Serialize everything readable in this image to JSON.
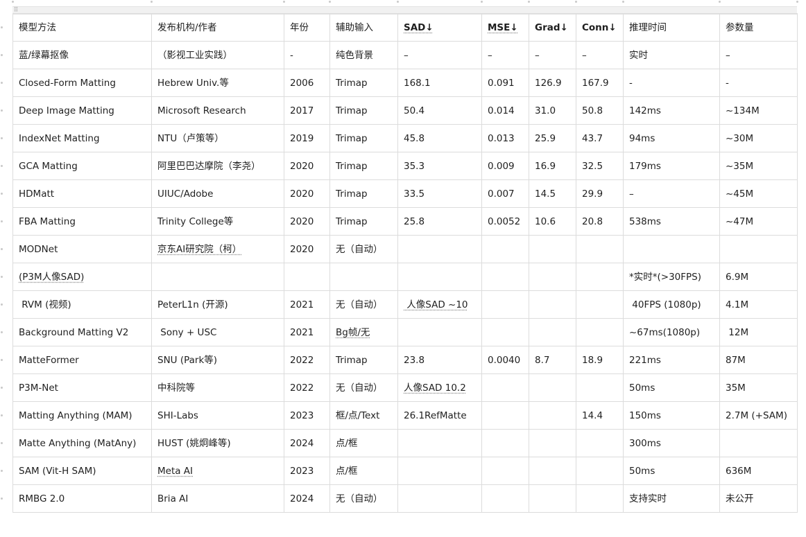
{
  "table": {
    "header": [
      "模型方法",
      "发布机构/作者",
      "年份",
      "辅助输入",
      "SAD↓",
      "MSE↓",
      "Grad↓",
      "Conn↓",
      "推理时间",
      "参数量"
    ],
    "rows": [
      [
        "蓝/绿幕抠像",
        "（影视工业实践）",
        "-",
        "纯色背景",
        "–",
        "–",
        "–",
        "–",
        "实时",
        "–"
      ],
      [
        "Closed-Form Matting",
        "Hebrew Univ.等",
        "2006",
        "Trimap",
        "168.1",
        "0.091",
        "126.9",
        "167.9",
        "-",
        "-"
      ],
      [
        "Deep Image Matting",
        "Microsoft Research",
        "2017",
        "Trimap",
        "50.4",
        "0.014",
        "31.0",
        "50.8",
        "142ms",
        "~134M"
      ],
      [
        "IndexNet Matting",
        "NTU（卢策等）",
        "2019",
        "Trimap",
        "45.8",
        "0.013",
        "25.9",
        "43.7",
        "94ms",
        "~30M"
      ],
      [
        "GCA Matting",
        "阿里巴巴达摩院（李尧）",
        "2020",
        "Trimap",
        "35.3",
        "0.009",
        "16.9",
        "32.5",
        "179ms",
        "~35M"
      ],
      [
        "HDMatt",
        "UIUC/Adobe",
        "2020",
        "Trimap",
        "33.5",
        "0.007",
        "14.5",
        "29.9",
        "–",
        "~45M"
      ],
      [
        "FBA Matting",
        "Trinity College等",
        "2020",
        "Trimap",
        "25.8",
        "0.0052",
        "10.6",
        "20.8",
        "538ms",
        "~47M"
      ],
      [
        "MODNet",
        "京东AI研究院（柯）",
        "2020",
        "无（自动）",
        "",
        "",
        "",
        "",
        "",
        ""
      ],
      [
        "(P3M人像SAD)",
        "",
        "",
        "",
        "",
        "",
        "",
        "",
        "*实时*(>30FPS)",
        "6.9M"
      ],
      [
        " RVM (视频)",
        "PeterL1n (开源)",
        "2021",
        "无（自动）",
        " 人像SAD ~10",
        "",
        "",
        "",
        " 40FPS (1080p)",
        "4.1M"
      ],
      [
        "Background Matting V2",
        " Sony + USC",
        "2021",
        "Bg帧/无",
        "",
        "",
        "",
        "",
        "~67ms(1080p)",
        " 12M"
      ],
      [
        "MatteFormer",
        "SNU (Park等)",
        "2022",
        "Trimap",
        "23.8",
        "0.0040",
        "8.7",
        "18.9",
        "221ms",
        "87M"
      ],
      [
        "P3M-Net",
        "中科院等",
        "2022",
        "无（自动）",
        "人像SAD 10.2",
        "",
        "",
        "",
        "50ms",
        "35M"
      ],
      [
        "Matting Anything (MAM)",
        "SHI-Labs",
        "2023",
        "框/点/Text",
        "26.1RefMatte",
        "",
        "",
        "14.4",
        "150ms",
        "2.7M (+SAM)"
      ],
      [
        "Matte Anything (MatAny)",
        "HUST (姚炯峰等)",
        "2024",
        "点/框",
        "",
        "",
        "",
        "",
        "300ms",
        ""
      ],
      [
        "SAM (Vit-H SAM)",
        "Meta AI",
        "2023",
        "点/框",
        "",
        "",
        "",
        "",
        "50ms",
        "636M"
      ],
      [
        "RMBG 2.0",
        "Bria AI",
        "2024",
        "无（自动）",
        "",
        "",
        "",
        "",
        "支持实时",
        "未公开"
      ]
    ]
  },
  "toolbar": {
    "drag_handle_icon": "drag-grip-icon"
  }
}
